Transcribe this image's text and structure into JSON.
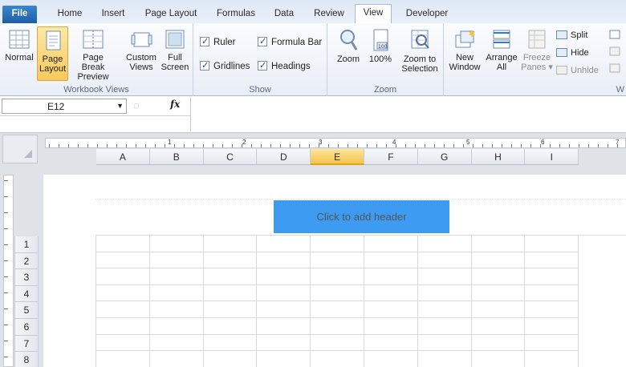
{
  "tabs": [
    "File",
    "Home",
    "Insert",
    "Page Layout",
    "Formulas",
    "Data",
    "Review",
    "View",
    "Developer"
  ],
  "ribbon": {
    "workbook_views": {
      "label": "Workbook Views",
      "buttons": [
        {
          "line1": "Normal",
          "line2": ""
        },
        {
          "line1": "Page",
          "line2": "Layout"
        },
        {
          "line1": "Page Break",
          "line2": "Preview"
        },
        {
          "line1": "Custom",
          "line2": "Views"
        },
        {
          "line1": "Full",
          "line2": "Screen"
        }
      ]
    },
    "show": {
      "label": "Show",
      "checks": [
        "Ruler",
        "Formula Bar",
        "Gridlines",
        "Headings"
      ]
    },
    "zoom": {
      "label": "Zoom",
      "buttons": [
        {
          "line1": "Zoom",
          "line2": ""
        },
        {
          "line1": "100%",
          "line2": ""
        },
        {
          "line1": "Zoom to",
          "line2": "Selection"
        }
      ]
    },
    "window": {
      "label": "W",
      "buttons": [
        {
          "line1": "New",
          "line2": "Window"
        },
        {
          "line1": "Arrange",
          "line2": "All"
        },
        {
          "line1": "Freeze",
          "line2": "Panes ▾"
        }
      ],
      "small": [
        "Split",
        "Hide",
        "Unhide"
      ]
    }
  },
  "formula_bar": {
    "name_box": "E12",
    "fx": "fx",
    "value": ""
  },
  "ruler_numbers": [
    "1",
    "2",
    "3",
    "4",
    "5",
    "6",
    "7"
  ],
  "columns": [
    "A",
    "B",
    "C",
    "D",
    "E",
    "F",
    "G",
    "H",
    "I"
  ],
  "selected_column": "E",
  "rows": [
    "1",
    "2",
    "3",
    "4",
    "5",
    "6",
    "7",
    "8"
  ],
  "header_placeholder": "Click to add header",
  "colors": {
    "accent": "#3d9bf2",
    "selected_header": "#f4c44f"
  }
}
